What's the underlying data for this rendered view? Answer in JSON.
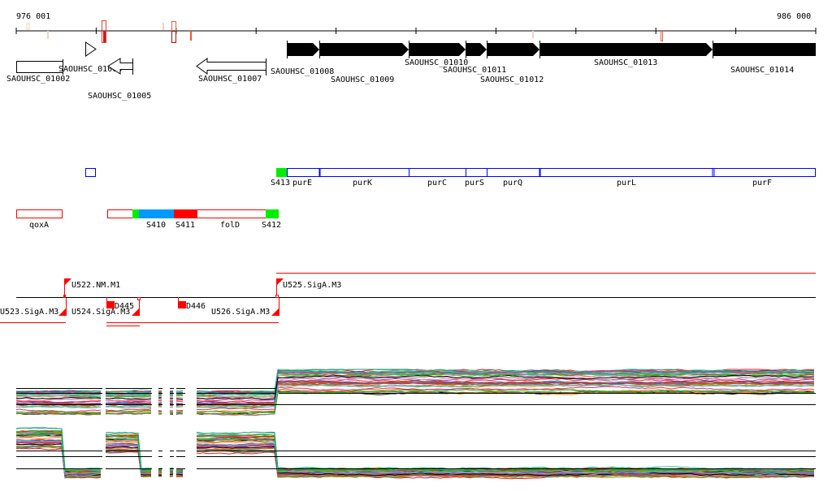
{
  "coordinates": {
    "start_label": "976 001",
    "end_label": "986 000",
    "tick_count": 11
  },
  "genes": [
    {
      "id": "SAOUHSC_01002",
      "strand": "+",
      "fill": "none"
    },
    {
      "id": "SAOUHSC_01003",
      "strand": "+",
      "fill": "none"
    },
    {
      "id": "SAOUHSC_01005",
      "strand": "-",
      "fill": "none"
    },
    {
      "id": "SAOUHSC_01007",
      "strand": "-",
      "fill": "none"
    },
    {
      "id": "SAOUHSC_01008",
      "strand": "+",
      "fill": "black"
    },
    {
      "id": "SAOUHSC_01009",
      "strand": "+",
      "fill": "black"
    },
    {
      "id": "SAOUHSC_01010",
      "strand": "+",
      "fill": "black"
    },
    {
      "id": "SAOUHSC_01011",
      "strand": "+",
      "fill": "black"
    },
    {
      "id": "SAOUHSC_01012",
      "strand": "+",
      "fill": "black"
    },
    {
      "id": "SAOUHSC_01013",
      "strand": "+",
      "fill": "black"
    },
    {
      "id": "SAOUHSC_01014",
      "strand": "+",
      "fill": "black"
    }
  ],
  "plus_features": {
    "segment": "S413",
    "genes": [
      "purE",
      "purK",
      "purC",
      "purS",
      "purQ",
      "purL",
      "purF"
    ]
  },
  "minus_features": {
    "gene_left": "qoxA",
    "segments": [
      "S410",
      "S411",
      "folD",
      "S412"
    ]
  },
  "promoters": {
    "plus": [
      "U522.NM.M1",
      "U525.SigA.M3"
    ],
    "minus": [
      "U523.SigA.M3",
      "U524.SigA.M3",
      "U526.SigA.M3"
    ],
    "deletions": [
      "D445",
      "D446"
    ]
  },
  "colors": {
    "red": "#ff0000",
    "green": "#00ee00",
    "blue": "#0000ff",
    "cyan_blue": "#0099ff",
    "series": [
      "#e41a1c",
      "#377eb8",
      "#4daf4a",
      "#984ea3",
      "#ff7f00",
      "#a6a61a",
      "#a65628",
      "#f781bf",
      "#999999",
      "#66c2a5",
      "#d95f02",
      "#7570b3",
      "#e7298a",
      "#1b9e77",
      "#8c6d31",
      "#00cc00",
      "#cc4c02",
      "#6a3d9a",
      "#000000",
      "#56b4e9"
    ]
  }
}
